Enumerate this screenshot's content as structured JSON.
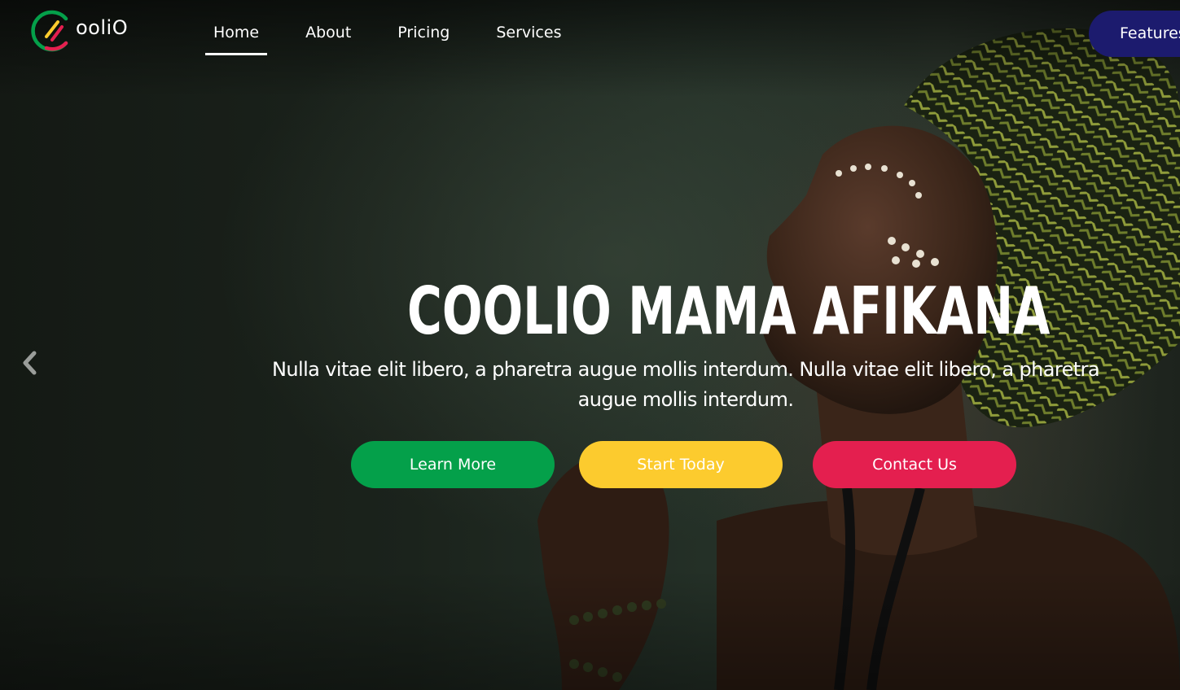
{
  "brand": {
    "logo_text": "ooliO",
    "logo_icon": "coolio-c-logo-icon",
    "colors": {
      "green": "#04a04a",
      "yellow": "#fccb2e",
      "red": "#e41f4f"
    }
  },
  "nav": {
    "items": [
      {
        "label": "Home",
        "active": true
      },
      {
        "label": "About",
        "active": false
      },
      {
        "label": "Pricing",
        "active": false
      },
      {
        "label": "Services",
        "active": false
      }
    ],
    "features_label": "Features",
    "features_color": "#1c1b6e"
  },
  "hero": {
    "title": "COOLIO MAMA AFIKANA",
    "description": "Nulla vitae elit libero, a pharetra augue mollis interdum. Nulla vitae elit libero, a pharetra augue mollis interdum.",
    "buttons": {
      "learn_more": "Learn More",
      "start_today": "Start Today",
      "contact_us": "Contact Us"
    },
    "prev_icon": "chevron-left-icon"
  }
}
